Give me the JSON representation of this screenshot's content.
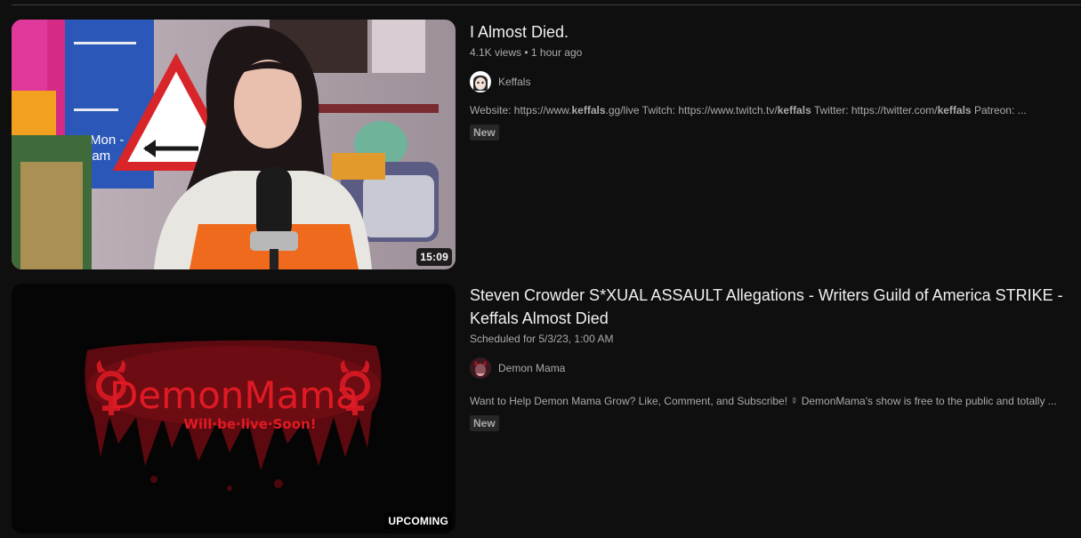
{
  "results": [
    {
      "title": "I Almost Died.",
      "views": "4.1K views",
      "separator": "•",
      "time": "1 hour ago",
      "duration": "15:09",
      "channel": "Keffals",
      "description": {
        "p1": "Website: https://www.",
        "b1": "keffals",
        "p2": ".gg/live Twitch: https://www.twitch.tv/",
        "b2": "keffals",
        "p3": " Twitter: https://twitter.com/",
        "b3": "keffals",
        "p4": " Patreon: ..."
      },
      "badge": "New"
    },
    {
      "title": "Steven Crowder S*XUAL ASSAULT Allegations - Writers Guild of America STRIKE - Keffals Almost Died",
      "schedule": "Scheduled for 5/3/23, 1:00 AM",
      "duration": "UPCOMING",
      "channel": "Demon Mama",
      "thumb_text": {
        "line1": "DemonMama",
        "line2": "Will·be·live·Soon!"
      },
      "description": "Want to Help Demon Mama Grow? Like, Comment, and Subscribe! ☿ DemonMama's show is free to the public and totally ...",
      "badge": "New"
    }
  ],
  "colors": {
    "background": "#0f0f0f",
    "text_primary": "#f1f1f1",
    "text_secondary": "#aaaaaa",
    "badge_bg": "#272727",
    "demon_red": "#c0121a"
  }
}
